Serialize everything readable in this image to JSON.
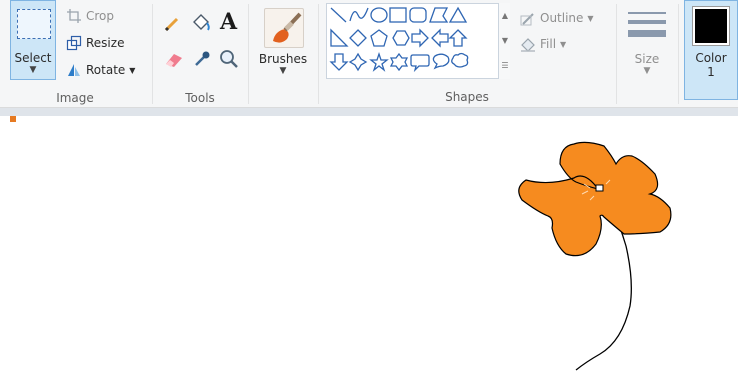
{
  "ribbon": {
    "image_group": {
      "label": "Image",
      "select_label": "Select",
      "crop_label": "Crop",
      "resize_label": "Resize",
      "rotate_label": "Rotate"
    },
    "tools_group": {
      "label": "Tools",
      "tools": [
        "pencil-icon",
        "fill-icon",
        "text-icon",
        "eraser-icon",
        "color-picker-icon",
        "magnifier-icon"
      ]
    },
    "brushes_label": "Brushes",
    "shapes_group": {
      "label": "Shapes",
      "outline_label": "Outline",
      "fill_label": "Fill",
      "shapes": [
        "line",
        "curve",
        "oval",
        "rectangle",
        "rounded-rectangle",
        "polygon",
        "triangle",
        "right-triangle",
        "diamond",
        "pentagon",
        "hexagon",
        "right-arrow",
        "left-arrow",
        "up-arrow",
        "down-arrow",
        "four-point-star",
        "five-point-star",
        "six-point-star",
        "rounded-callout",
        "oval-callout",
        "cloud-callout"
      ]
    },
    "size_label": "Size",
    "color1": {
      "label": "Color",
      "number": "1",
      "color": "#000000"
    }
  },
  "canvas": {
    "drawing": "flower",
    "petal_color": "#f68b1f",
    "stem_color": "#000000"
  }
}
